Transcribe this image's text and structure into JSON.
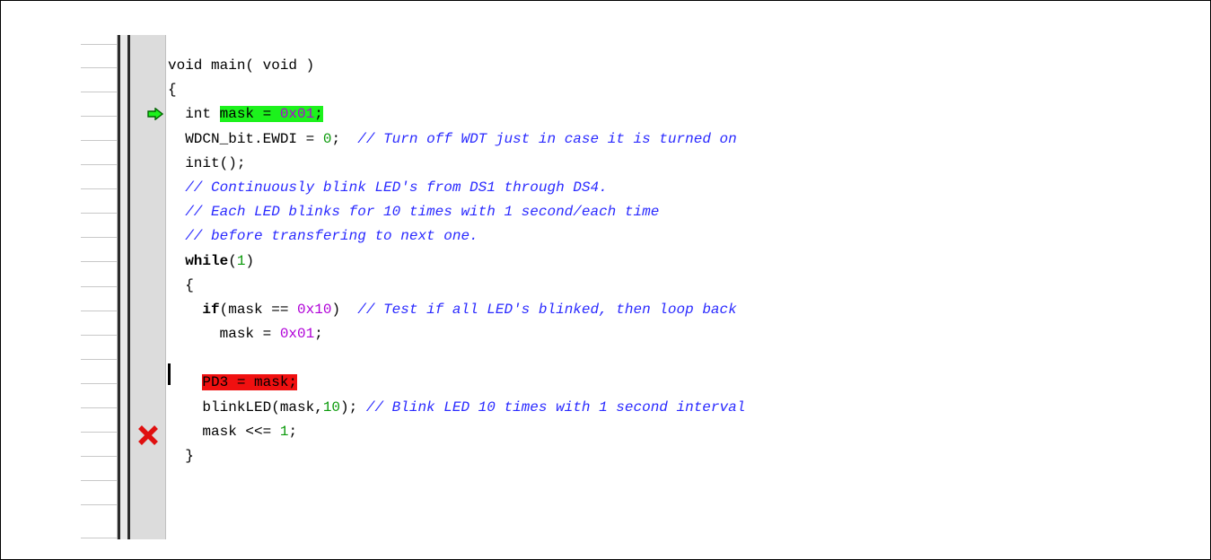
{
  "editor": {
    "colors": {
      "current_line_highlight": "#1cf21c",
      "breakpoint_highlight": "#f01010",
      "comment": "#2a2aff",
      "number": "#0a9a0a",
      "hex_literal": "#b000d8"
    },
    "gutter": {
      "current_statement_marker": "green-arrow-icon",
      "breakpoint_marker": "red-x-icon"
    },
    "lines": [
      {
        "code": "void main( void )"
      },
      {
        "code": "{"
      },
      {
        "indent": "  ",
        "pre": "int ",
        "hl": "mask = ",
        "hl_hex": "0x01",
        "hl_post": ";"
      },
      {
        "indent": "  ",
        "pre": "WDCN_bit.EWDI = ",
        "num": "0",
        "post": ";  ",
        "comment": "// Turn off WDT just in case it is turned on"
      },
      {
        "indent": "  ",
        "code": "init();"
      },
      {
        "indent": "  ",
        "comment": "// Continuously blink LED's from DS1 through DS4."
      },
      {
        "indent": "  ",
        "comment": "// Each LED blinks for 10 times with 1 second/each time"
      },
      {
        "indent": "  ",
        "comment": "// before transfering to next one."
      },
      {
        "indent": "  ",
        "kw": "while",
        "pre": "(",
        "num": "1",
        "post": ")"
      },
      {
        "indent": "  ",
        "code": "{"
      },
      {
        "indent": "    ",
        "kw": "if",
        "pre": "(mask == ",
        "hex": "0x10",
        "post": ")  ",
        "comment": "// Test if all LED's blinked, then loop back"
      },
      {
        "indent": "      ",
        "pre": "mask = ",
        "hex": "0x01",
        "post": ";"
      },
      {
        "code": ""
      },
      {
        "indent": "    ",
        "bp": "PD3 = mask;"
      },
      {
        "indent": "    ",
        "pre": "blinkLED(mask,",
        "num": "10",
        "post": "); ",
        "comment": "// Blink LED 10 times with 1 second interval"
      },
      {
        "indent": "    ",
        "pre": "mask <<= ",
        "num": "1",
        "post": ";"
      },
      {
        "indent": "  ",
        "code": "}"
      }
    ]
  }
}
